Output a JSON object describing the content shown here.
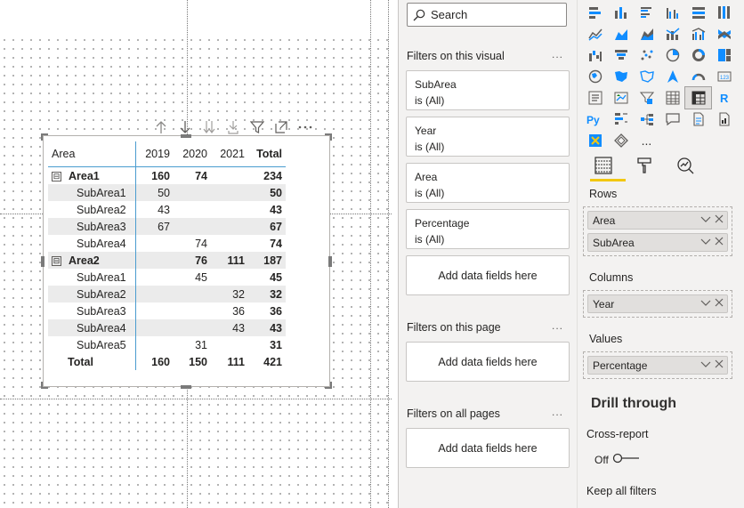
{
  "visual": {
    "header_icons": [
      "arrow-up-icon",
      "arrow-down-icon",
      "double-arrow-down-icon",
      "expand-down-icon",
      "filter-icon",
      "focus-mode-icon",
      "more-options-icon"
    ],
    "matrix": {
      "columns": [
        "Area",
        "2019",
        "2020",
        "2021",
        "Total"
      ],
      "rows": [
        {
          "label": "Area1",
          "level": 0,
          "v2019": "160",
          "v2020": "74",
          "v2021": "",
          "total": "234",
          "expander": "⊟",
          "shade": false
        },
        {
          "label": "SubArea1",
          "level": 1,
          "v2019": "50",
          "v2020": "",
          "v2021": "",
          "total": "50",
          "shade": true
        },
        {
          "label": "SubArea2",
          "level": 1,
          "v2019": "43",
          "v2020": "",
          "v2021": "",
          "total": "43",
          "shade": false
        },
        {
          "label": "SubArea3",
          "level": 1,
          "v2019": "67",
          "v2020": "",
          "v2021": "",
          "total": "67",
          "shade": true
        },
        {
          "label": "SubArea4",
          "level": 1,
          "v2019": "",
          "v2020": "74",
          "v2021": "",
          "total": "74",
          "shade": false
        },
        {
          "label": "Area2",
          "level": 0,
          "v2019": "",
          "v2020": "76",
          "v2021": "111",
          "total": "187",
          "expander": "⊟",
          "shade": true
        },
        {
          "label": "SubArea1",
          "level": 1,
          "v2019": "",
          "v2020": "45",
          "v2021": "",
          "total": "45",
          "shade": false
        },
        {
          "label": "SubArea2",
          "level": 1,
          "v2019": "",
          "v2020": "",
          "v2021": "32",
          "total": "32",
          "shade": true
        },
        {
          "label": "SubArea3",
          "level": 1,
          "v2019": "",
          "v2020": "",
          "v2021": "36",
          "total": "36",
          "shade": false
        },
        {
          "label": "SubArea4",
          "level": 1,
          "v2019": "",
          "v2020": "",
          "v2021": "43",
          "total": "43",
          "shade": true
        },
        {
          "label": "SubArea5",
          "level": 1,
          "v2019": "",
          "v2020": "31",
          "v2021": "",
          "total": "31",
          "shade": false
        }
      ],
      "grand_total": {
        "label": "Total",
        "v2019": "160",
        "v2020": "150",
        "v2021": "111",
        "total": "421"
      }
    }
  },
  "filters": {
    "search_placeholder": "Search",
    "on_visual_title": "Filters on this visual",
    "more": "...",
    "visual_cards": [
      {
        "field": "SubArea",
        "state": "is (All)"
      },
      {
        "field": "Year",
        "state": "is (All)"
      },
      {
        "field": "Area",
        "state": "is (All)"
      },
      {
        "field": "Percentage",
        "state": "is (All)"
      }
    ],
    "add_fields": "Add data fields here",
    "on_page_title": "Filters on this page",
    "on_all_pages_title": "Filters on all pages"
  },
  "visualizations": {
    "more_visuals": "...",
    "rows_label": "Rows",
    "rows_fields": [
      "Area",
      "SubArea"
    ],
    "columns_label": "Columns",
    "columns_fields": [
      "Year"
    ],
    "values_label": "Values",
    "values_fields": [
      "Percentage"
    ],
    "drill_title": "Drill through",
    "cross_report": "Cross-report",
    "toggle_state": "Off",
    "keep_filters": "Keep all filters",
    "accent": "#f2c811"
  }
}
